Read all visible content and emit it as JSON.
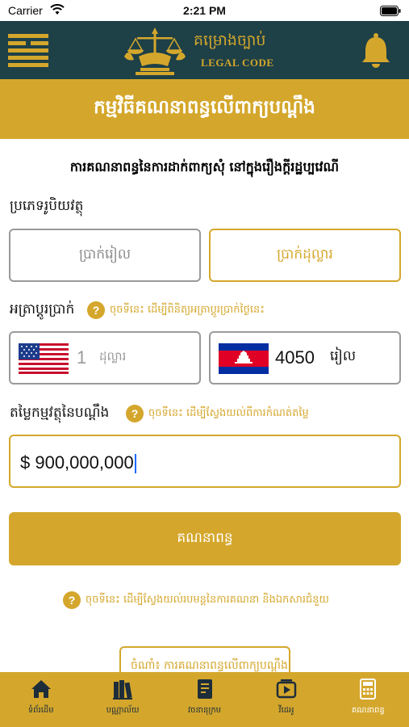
{
  "status_bar": {
    "carrier": "Carrier",
    "time": "2:21 PM"
  },
  "header": {
    "logo_title": "គម្រោងច្បាប់",
    "logo_subtitle": "LEGAL CODE"
  },
  "banner": {
    "title": "កម្មវិធីគណនាពន្ធលើពាក្យបណ្តឹង"
  },
  "page_subtitle": "ការគណនាពន្ធនៃការដាក់ពាក្យសុំ នៅក្នុងរឿងក្តីរដ្ឋប្បវេណី",
  "currency_section": {
    "label": "ប្រភេទរូបិយវត្ថុ",
    "riel_button": "ប្រាក់រៀល",
    "dollar_button": "ប្រាក់ដុល្លារ",
    "selected": "dollar"
  },
  "exchange_section": {
    "label": "អត្រាប្តូរប្រាក់",
    "help_text": "ចុចទីនេះ ដើម្បីពិនិត្យអត្រាប្តូរប្រាក់ថ្ងៃនេះ",
    "usd_amount": "1",
    "usd_unit": "ដុល្លារ",
    "khr_amount": "4050",
    "khr_unit": "រៀល"
  },
  "value_section": {
    "label": "តម្លៃកម្មវត្ថុនៃបណ្តឹង",
    "help_text": "ចុចទីនេះ ដើម្បីស្វែងយល់ពីការកំណត់តម្លៃ",
    "input_value": "$ 900,000,000"
  },
  "calculate_button": "គណនាពន្ធ",
  "footer_help": "ចុចទីនេះ ដើម្បីស្វែងយល់របមន្តនៃការគណនា និងឯកសារជំនួយ",
  "partial_button": "ចំណាំ៖ ការគណនាពន្ធលើពាក្យបណ្តឹង",
  "colors": {
    "gold": "#d4a72c",
    "dark_teal": "#1e4047"
  },
  "bottom_nav": {
    "active": "calculator",
    "items": [
      {
        "label": "ទំព័រដើម",
        "icon": "home-icon"
      },
      {
        "label": "បណ្ណាល័យ",
        "icon": "library-icon"
      },
      {
        "label": "វចនានុក្រម",
        "icon": "dictionary-icon"
      },
      {
        "label": "វីដេអូ",
        "icon": "video-icon"
      },
      {
        "label": "គណនាពន្ធ",
        "icon": "calculator-icon"
      }
    ]
  }
}
